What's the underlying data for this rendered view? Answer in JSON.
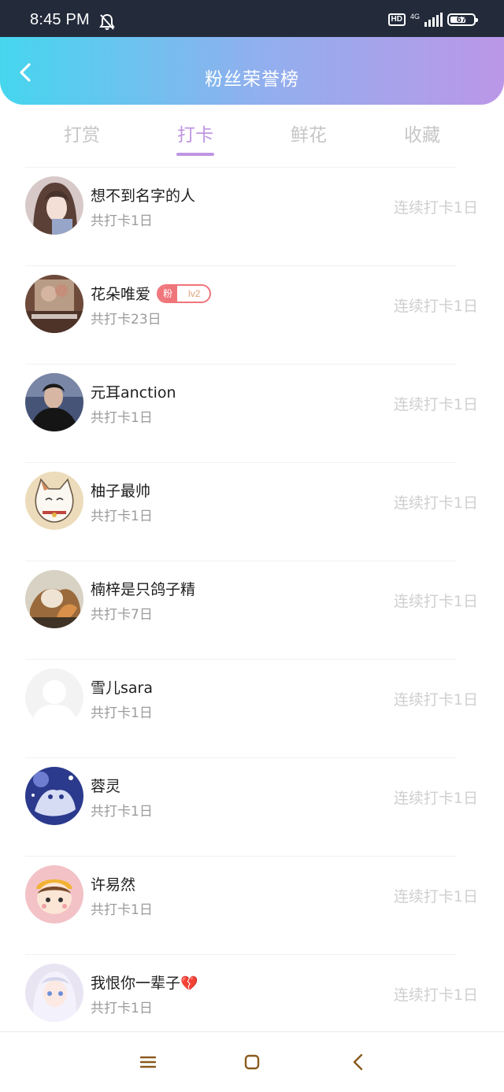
{
  "status_bar": {
    "time": "8:45 PM",
    "hd": "HD",
    "network": "4G",
    "battery": "67",
    "battery_level": 0.67,
    "icons": [
      "bell-muted-icon",
      "signal-icon",
      "battery-icon"
    ]
  },
  "header": {
    "title": "粉丝荣誉榜",
    "back_icon": "chevron-left-icon",
    "gradient": [
      "#45d6ee",
      "#bb97e8"
    ]
  },
  "tabs": [
    {
      "label": "打赏",
      "active": false
    },
    {
      "label": "打卡",
      "active": true
    },
    {
      "label": "鲜花",
      "active": false
    },
    {
      "label": "收藏",
      "active": false
    }
  ],
  "accent_color": "#bf96e2",
  "fans": [
    {
      "name": "想不到名字的人",
      "total": "共打卡1日",
      "streak": "连续打卡1日"
    },
    {
      "name": "花朵唯爱",
      "total": "共打卡23日",
      "streak": "连续打卡1日",
      "badge": {
        "label": "粉",
        "level": "lv2"
      }
    },
    {
      "name": "元耳anction",
      "total": "共打卡1日",
      "streak": "连续打卡1日"
    },
    {
      "name": "柚子最帅",
      "total": "共打卡1日",
      "streak": "连续打卡1日"
    },
    {
      "name": "楠梓是只鸽子精",
      "total": "共打卡7日",
      "streak": "连续打卡1日"
    },
    {
      "name": "雪儿sara",
      "total": "共打卡1日",
      "streak": "连续打卡1日"
    },
    {
      "name": "蓉灵",
      "total": "共打卡1日",
      "streak": "连续打卡1日"
    },
    {
      "name": "许易然",
      "total": "共打卡1日",
      "streak": "连续打卡1日"
    },
    {
      "name": "我恨你一辈子",
      "suffix": "💔",
      "total": "共打卡1日",
      "streak": "连续打卡1日"
    }
  ],
  "nav_bar": {
    "icons": [
      "menu-icon",
      "home-square-icon",
      "back-triangle-icon"
    ]
  }
}
